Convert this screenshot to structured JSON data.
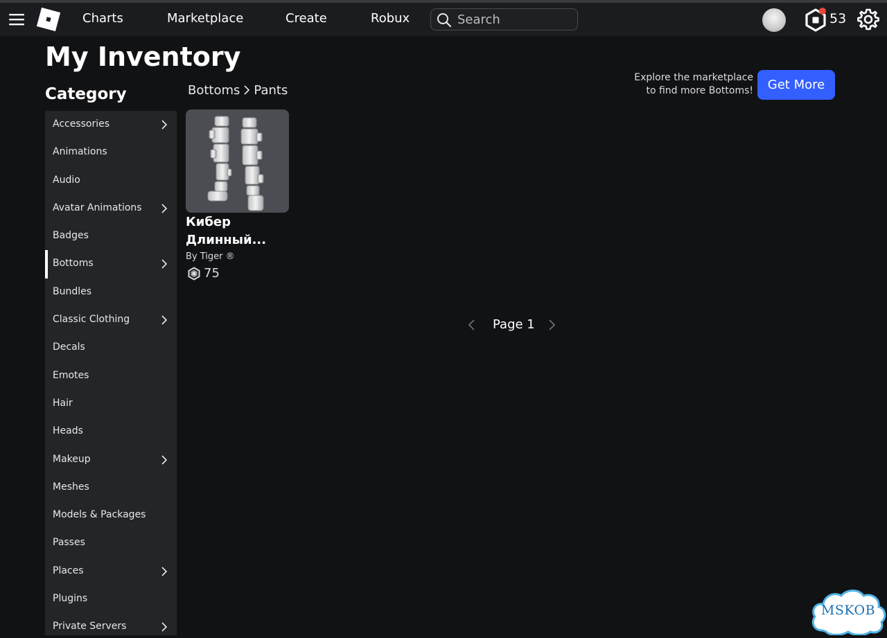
{
  "nav": {
    "links": [
      "Charts",
      "Marketplace",
      "Create",
      "Robux"
    ],
    "search_placeholder": "Search",
    "robux_balance": "53"
  },
  "page": {
    "title": "My Inventory",
    "category_heading": "Category"
  },
  "sidebar": {
    "active_index": 5,
    "items": [
      {
        "label": "Accessories",
        "has_children": true
      },
      {
        "label": "Animations",
        "has_children": false
      },
      {
        "label": "Audio",
        "has_children": false
      },
      {
        "label": "Avatar Animations",
        "has_children": true
      },
      {
        "label": "Badges",
        "has_children": false
      },
      {
        "label": "Bottoms",
        "has_children": true
      },
      {
        "label": "Bundles",
        "has_children": false
      },
      {
        "label": "Classic Clothing",
        "has_children": true
      },
      {
        "label": "Decals",
        "has_children": false
      },
      {
        "label": "Emotes",
        "has_children": false
      },
      {
        "label": "Hair",
        "has_children": false
      },
      {
        "label": "Heads",
        "has_children": false
      },
      {
        "label": "Makeup",
        "has_children": true
      },
      {
        "label": "Meshes",
        "has_children": false
      },
      {
        "label": "Models & Packages",
        "has_children": false
      },
      {
        "label": "Passes",
        "has_children": false
      },
      {
        "label": "Places",
        "has_children": true
      },
      {
        "label": "Plugins",
        "has_children": false
      },
      {
        "label": "Private Servers",
        "has_children": true
      }
    ]
  },
  "breadcrumb": [
    "Bottoms",
    "Pants"
  ],
  "promo": {
    "line1": "Explore the marketplace",
    "line2": "to find more Bottoms!",
    "button": "Get More"
  },
  "items": [
    {
      "name_line1": "Кибер",
      "name_line2": "Длинный...",
      "creator": "By Tiger ®",
      "price": "75"
    }
  ],
  "pagination": {
    "label": "Page 1"
  },
  "watermark": "MSKOB",
  "colors": {
    "background": "#111214",
    "topbar": "#1b1c1f",
    "sidebar": "#232527",
    "accent_button": "#335fff",
    "notification": "#e8453c"
  }
}
